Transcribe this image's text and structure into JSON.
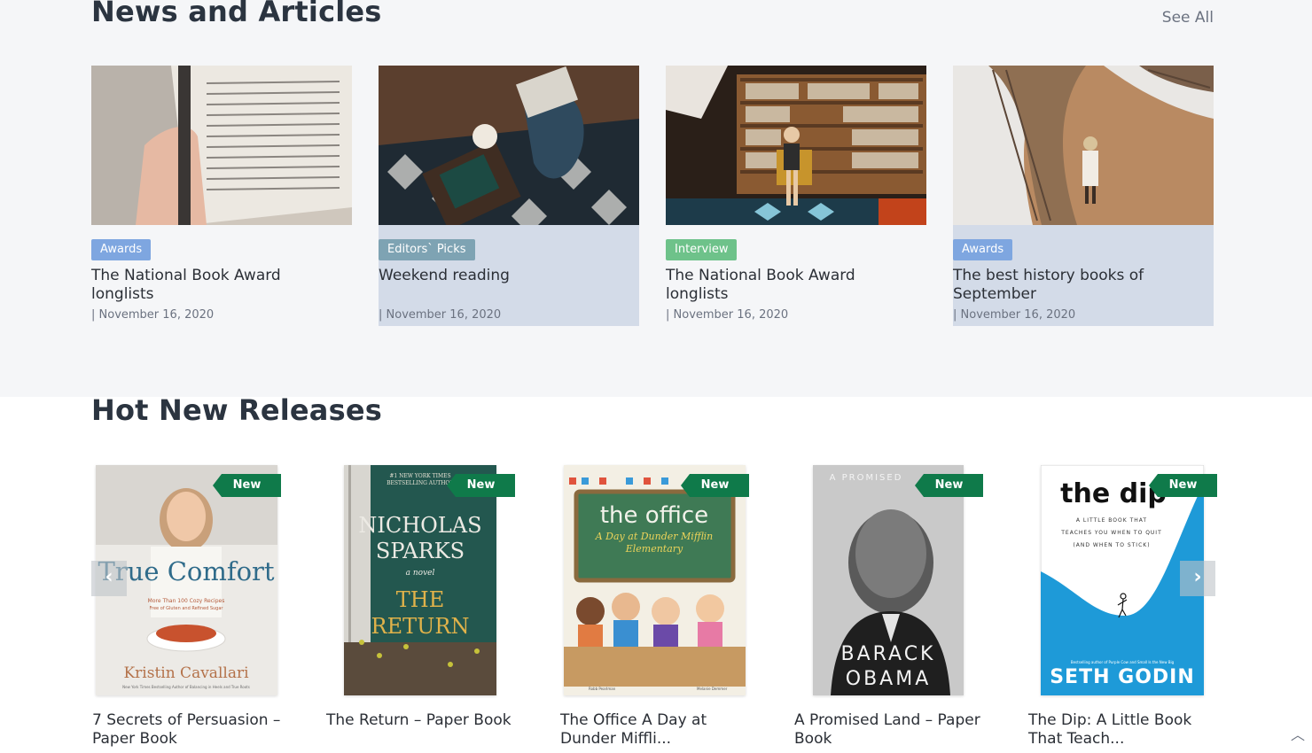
{
  "news": {
    "title": "News and Articles",
    "see_all": "See All",
    "articles": [
      {
        "badge": "Awards",
        "badge_color": "#7ea6e0",
        "title": "The National Book Award longlists",
        "date": "| November 16, 2020",
        "image": "book-pages-photo"
      },
      {
        "badge": "Editors` Picks",
        "badge_color": "#7ea3b3",
        "title": "Weekend reading",
        "date": "| November 16, 2020",
        "image": "reading-on-rug-photo"
      },
      {
        "badge": "Interview",
        "badge_color": "#6ec28a",
        "title": "The National Book Award longlists",
        "date": "| November 16, 2020",
        "image": "library-interview-photo"
      },
      {
        "badge": "Awards",
        "badge_color": "#7ea6e0",
        "title": "The best history books of September",
        "date": "| November 16, 2020",
        "image": "curved-library-photo"
      }
    ]
  },
  "releases": {
    "title": "Hot New Releases",
    "badge_label": "New",
    "prev_icon": "chevron-left-icon",
    "next_icon": "chevron-right-icon",
    "books": [
      {
        "title": "7 Secrets of Persuasion – Paper Book",
        "cover": {
          "main_title": "True Comfort",
          "tagline": "More Than 100 Cozy Recipes",
          "tagline2": "Free of Gluten and Refined Sugar",
          "author": "Kristin Cavallari",
          "author_note": "New York Times Bestselling Author of Balancing in Heels and True Roots"
        }
      },
      {
        "title": "The Return – Paper Book",
        "cover": {
          "top_note": "#1 NEW YORK TIMES",
          "top_note2": "BESTSELLING AUTHOR",
          "author_line1": "NICHOLAS",
          "author_line2": "SPARKS",
          "subtitle": "a novel",
          "title_line1": "THE",
          "title_line2": "RETURN"
        }
      },
      {
        "title": "The Office A Day at Dunder Miffli...",
        "cover": {
          "main_title": "the office",
          "subtitle": "A Day at Dunder Mifflin",
          "subtitle2": "Elementary",
          "credit1": "Robb Pearlman",
          "credit2": "Melanie Demmer"
        }
      },
      {
        "title": "A Promised Land – Paper Book",
        "cover": {
          "top": "A PROMISED",
          "author_line1": "BARACK",
          "author_line2": "OBAMA"
        }
      },
      {
        "title": "The Dip: A Little Book That Teach...",
        "cover": {
          "main_title": "the dip",
          "tagline1": "A LITTLE BOOK THAT",
          "tagline2": "TEACHES YOU WHEN TO QUIT",
          "tagline3": "(AND WHEN TO STICK)",
          "author_note": "Bestselling author of Purple Cow and Small Is the New Big",
          "author": "SETH GODIN"
        }
      }
    ]
  },
  "scroll_top_icon": "chevron-up-icon"
}
